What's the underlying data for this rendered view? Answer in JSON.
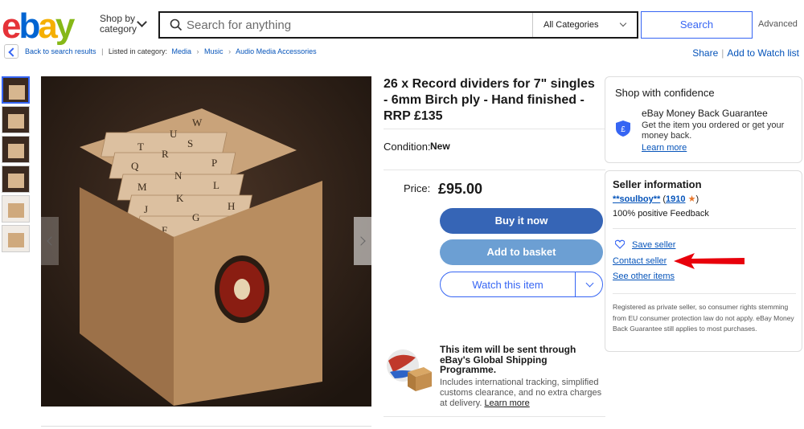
{
  "header": {
    "logo_letters": [
      "e",
      "b",
      "a",
      "y"
    ],
    "logo_colors": [
      "#e53238",
      "#0064d2",
      "#f5af02",
      "#86b817"
    ],
    "shop_by_category": "Shop by category",
    "search_placeholder": "Search for anything",
    "category_select": "All Categories",
    "search_button": "Search",
    "advanced_link": "Advanced"
  },
  "breadcrumb": {
    "back_label": "Back to search results",
    "listed_in": "Listed in category:",
    "items": [
      "Media",
      "Music",
      "Audio Media Accessories"
    ],
    "share": "Share",
    "watch_list": "Add to Watch list"
  },
  "gallery": {
    "thumbnail_count": 6
  },
  "listing": {
    "title": "26 x Record dividers for 7\" singles - 6mm Birch ply - Hand finished - RRP £135",
    "condition_label": "Condition:",
    "condition_value": "New",
    "price_label": "Price:",
    "price_value": "£95.00",
    "buy_now": "Buy it now",
    "add_to_basket": "Add to basket",
    "watch_item": "Watch this item",
    "shipping_title": "This item will be sent through eBay's Global Shipping Programme.",
    "shipping_text": "Includes international tracking, simplified customs clearance, and no extra charges at delivery.",
    "shipping_link": "Learn more"
  },
  "confidence": {
    "title": "Shop with confidence",
    "guarantee_title": "eBay Money Back Guarantee",
    "guarantee_text": "Get the item you ordered or get your money back.",
    "learn_more": "Learn more"
  },
  "seller": {
    "title": "Seller information",
    "name": "**soulboy**",
    "feedback_count": "1910",
    "positive_feedback": "100% positive Feedback",
    "save_seller": "Save seller",
    "contact_seller": "Contact seller",
    "see_other_items": "See other items",
    "private_note": "Registered as private seller, so consumer rights stemming from EU consumer protection law do not apply. eBay Money Back Guarantee still applies to most purchases."
  },
  "colors": {
    "accent": "#3665f3",
    "buy_button": "#3665b6",
    "basket_button": "#6c9fd3",
    "annotation_arrow": "#e8000b"
  }
}
